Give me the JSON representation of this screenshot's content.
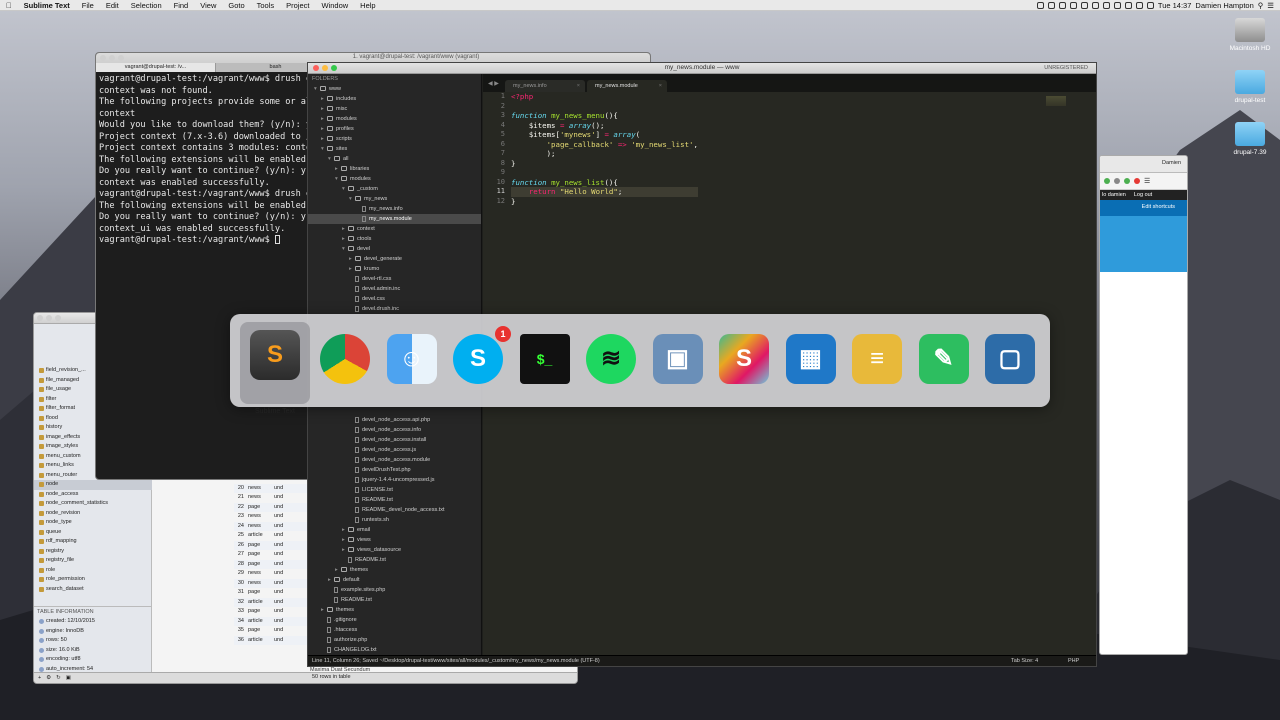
{
  "menubar": {
    "app_name": "Sublime Text",
    "menus": [
      "File",
      "Edit",
      "Selection",
      "Find",
      "View",
      "Goto",
      "Tools",
      "Project",
      "Window",
      "Help"
    ],
    "clock": "Tue 14:37",
    "user": "Damien Hampton"
  },
  "desktop": {
    "icons": [
      {
        "label": "Macintosh HD",
        "icon": "hard-drive-icon"
      },
      {
        "label": "drupal-test",
        "icon": "folder-icon"
      },
      {
        "label": "drupal-7.39",
        "icon": "folder-icon"
      }
    ]
  },
  "terminal": {
    "window_title": "1. vagrant@drupal-test: /vagrant/www (vagrant)",
    "tabs": [
      "vagrant@drupal-test: /v...",
      "bash"
    ],
    "lines": [
      "vagrant@drupal-test:/vagrant/www$ drush en",
      "context was not found.",
      "The following projects provide some or all",
      "context",
      "Would you like to download them? (y/n): y",
      "Project context (7.x-3.6) downloaded to /v",
      "Project context contains 3 modules: contex",
      "The following extensions will be enabled:",
      "Do you really want to continue? (y/n): y",
      "context was enabled successfully.",
      "vagrant@drupal-test:/vagrant/www$ drush en",
      "The following extensions will be enabled:",
      "Do you really want to continue? (y/n): y",
      "context_ui was enabled successfully.",
      "vagrant@drupal-test:/vagrant/www$ "
    ]
  },
  "db": {
    "tables": [
      "field_revision_...",
      "file_managed",
      "file_usage",
      "filter",
      "filter_format",
      "flood",
      "history",
      "image_effects",
      "image_styles",
      "menu_custom",
      "menu_links",
      "menu_router",
      "node",
      "node_access",
      "node_comment_statistics",
      "node_revision",
      "node_type",
      "queue",
      "rdf_mapping",
      "registry",
      "registry_file",
      "role",
      "role_permission",
      "search_dataset"
    ],
    "selected_table": "node",
    "info_header": "TABLE INFORMATION",
    "info": [
      "created: 12/10/2015",
      "engine: InnoDB",
      "rows: 50",
      "size: 16.0 KiB",
      "encoding: utf8",
      "auto_increment: 54"
    ],
    "rows": [
      [
        "15",
        "article",
        "und"
      ],
      [
        "16",
        "news",
        "und"
      ],
      [
        "17",
        "page",
        "und"
      ],
      [
        "18",
        "article",
        "und"
      ],
      [
        "19",
        "news",
        "und"
      ],
      [
        "20",
        "news",
        "und"
      ],
      [
        "21",
        "news",
        "und"
      ],
      [
        "22",
        "page",
        "und"
      ],
      [
        "23",
        "news",
        "und"
      ],
      [
        "24",
        "news",
        "und"
      ],
      [
        "25",
        "article",
        "und"
      ],
      [
        "26",
        "page",
        "und"
      ],
      [
        "27",
        "page",
        "und"
      ],
      [
        "28",
        "page",
        "und"
      ],
      [
        "29",
        "news",
        "und"
      ],
      [
        "30",
        "news",
        "und"
      ],
      [
        "31",
        "page",
        "und"
      ],
      [
        "32",
        "article",
        "und"
      ],
      [
        "33",
        "page",
        "und"
      ],
      [
        "34",
        "article",
        "und"
      ],
      [
        "35",
        "page",
        "und"
      ],
      [
        "36",
        "article",
        "und"
      ]
    ],
    "status": "50 rows in table",
    "footer_text": "Maxima Duat Secundum"
  },
  "browser": {
    "user": "Damien",
    "admin_links": [
      "lo damien",
      "Log out"
    ],
    "shortcuts": "Edit shortcuts"
  },
  "sublime": {
    "title": "my_news.module — www",
    "unregistered": "UNREGISTERED",
    "folders_header": "FOLDERS",
    "tabs": [
      {
        "label": "my_news.info",
        "active": false
      },
      {
        "label": "my_news.module",
        "active": true
      }
    ],
    "tree": [
      {
        "d": 0,
        "t": "folder",
        "n": "www",
        "o": true
      },
      {
        "d": 1,
        "t": "folder",
        "n": "includes"
      },
      {
        "d": 1,
        "t": "folder",
        "n": "misc"
      },
      {
        "d": 1,
        "t": "folder",
        "n": "modules"
      },
      {
        "d": 1,
        "t": "folder",
        "n": "profiles"
      },
      {
        "d": 1,
        "t": "folder",
        "n": "scripts"
      },
      {
        "d": 1,
        "t": "folder",
        "n": "sites",
        "o": true
      },
      {
        "d": 2,
        "t": "folder",
        "n": "all",
        "o": true
      },
      {
        "d": 3,
        "t": "folder",
        "n": "libraries"
      },
      {
        "d": 3,
        "t": "folder",
        "n": "modules",
        "o": true
      },
      {
        "d": 4,
        "t": "folder",
        "n": "_custom",
        "o": true
      },
      {
        "d": 5,
        "t": "folder",
        "n": "my_news",
        "o": true
      },
      {
        "d": 6,
        "t": "file",
        "n": "my_news.info"
      },
      {
        "d": 6,
        "t": "file",
        "n": "my_news.module",
        "sel": true
      },
      {
        "d": 4,
        "t": "folder",
        "n": "context"
      },
      {
        "d": 4,
        "t": "folder",
        "n": "ctools"
      },
      {
        "d": 4,
        "t": "folder",
        "n": "devel",
        "o": true
      },
      {
        "d": 5,
        "t": "folder",
        "n": "devel_generate"
      },
      {
        "d": 5,
        "t": "folder",
        "n": "krumo"
      },
      {
        "d": 5,
        "t": "file",
        "n": "devel-rtl.css"
      },
      {
        "d": 5,
        "t": "file",
        "n": "devel.admin.inc"
      },
      {
        "d": 5,
        "t": "file",
        "n": "devel.css"
      },
      {
        "d": 5,
        "t": "file",
        "n": "devel.drush.inc"
      }
    ],
    "tree_lower": [
      {
        "d": 5,
        "t": "file",
        "n": "devel_node_access.api.php"
      },
      {
        "d": 5,
        "t": "file",
        "n": "devel_node_access.info"
      },
      {
        "d": 5,
        "t": "file",
        "n": "devel_node_access.install"
      },
      {
        "d": 5,
        "t": "file",
        "n": "devel_node_access.js"
      },
      {
        "d": 5,
        "t": "file",
        "n": "devel_node_access.module"
      },
      {
        "d": 5,
        "t": "file",
        "n": "develDrushTest.php"
      },
      {
        "d": 5,
        "t": "file",
        "n": "jquery-1.4.4-uncompressed.js"
      },
      {
        "d": 5,
        "t": "file",
        "n": "LICENSE.txt"
      },
      {
        "d": 5,
        "t": "file",
        "n": "README.txt"
      },
      {
        "d": 5,
        "t": "file",
        "n": "README_devel_node_access.txt"
      },
      {
        "d": 5,
        "t": "file",
        "n": "runtests.sh"
      },
      {
        "d": 4,
        "t": "folder",
        "n": "email"
      },
      {
        "d": 4,
        "t": "folder",
        "n": "views"
      },
      {
        "d": 4,
        "t": "folder",
        "n": "views_datasource"
      },
      {
        "d": 4,
        "t": "file",
        "n": "README.txt"
      },
      {
        "d": 3,
        "t": "folder",
        "n": "themes"
      },
      {
        "d": 2,
        "t": "folder",
        "n": "default"
      },
      {
        "d": 2,
        "t": "file",
        "n": "example.sites.php"
      },
      {
        "d": 2,
        "t": "file",
        "n": "README.txt"
      },
      {
        "d": 1,
        "t": "folder",
        "n": "themes"
      },
      {
        "d": 1,
        "t": "file",
        "n": ".gitignore"
      },
      {
        "d": 1,
        "t": "file",
        "n": ".htaccess"
      },
      {
        "d": 1,
        "t": "file",
        "n": "authorize.php"
      },
      {
        "d": 1,
        "t": "file",
        "n": "CHANGELOG.txt"
      },
      {
        "d": 1,
        "t": "file",
        "n": "COPYRIGHT.txt"
      }
    ],
    "status_left": "Line 11, Column 26; Saved ~/Desktop/drupal-test/www/sites/all/modules/_custom/my_news/my_news.module (UTF-8)",
    "tab_size": "Tab Size: 4",
    "syntax": "PHP"
  },
  "switcher": {
    "apps": [
      {
        "name": "Sublime Text",
        "icon": "sublime-text-icon",
        "active": true,
        "color": "#4a4a4a"
      },
      {
        "name": "Google Chrome",
        "icon": "chrome-icon",
        "color": "#dd4b39"
      },
      {
        "name": "Finder",
        "icon": "finder-icon",
        "color": "#3a8ee6"
      },
      {
        "name": "Skype",
        "icon": "skype-icon",
        "badge": "1",
        "color": "#00aff0"
      },
      {
        "name": "Terminal",
        "icon": "terminal-icon",
        "color": "#111111"
      },
      {
        "name": "Spotify",
        "icon": "spotify-icon",
        "color": "#1ed760"
      },
      {
        "name": "Preview",
        "icon": "preview-icon",
        "color": "#6a8fb8"
      },
      {
        "name": "Slack",
        "icon": "slack-icon",
        "color": "#ffffff"
      },
      {
        "name": "Keynote",
        "icon": "keynote-icon",
        "color": "#1f78c8"
      },
      {
        "name": "Sequel Pro",
        "icon": "sequel-pro-icon",
        "color": "#e8b93a"
      },
      {
        "name": "Evernote",
        "icon": "evernote-icon",
        "color": "#2dbe60"
      },
      {
        "name": "VirtualBox",
        "icon": "virtualbox-icon",
        "color": "#2d6ca8"
      }
    ]
  }
}
